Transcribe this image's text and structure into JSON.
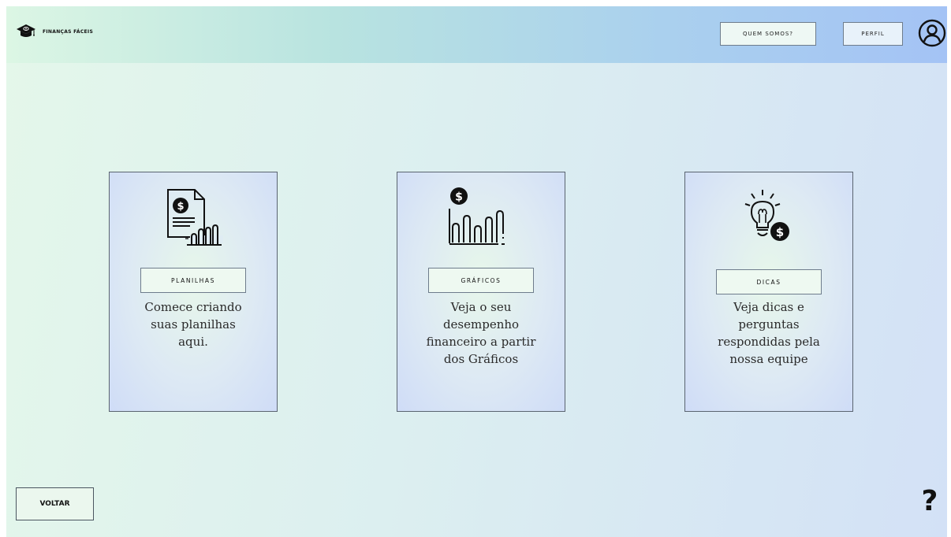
{
  "header": {
    "brand": "FINANÇAS FÁCEIS",
    "logo_icon": "graduation-cap-icon",
    "about_label": "QUEM SOMOS?",
    "profile_label": "PERFIL",
    "profile_icon": "user-circle-icon"
  },
  "cards": [
    {
      "icon": "spreadsheet-dollar-icon",
      "button_label": "PLANILHAS",
      "description": [
        "Comece criando",
        "suas planilhas",
        "aqui."
      ]
    },
    {
      "icon": "bar-chart-dollar-icon",
      "button_label": "GRÁFICOS",
      "description": [
        "Veja o seu",
        "desempenho",
        "financeiro a partir",
        "dos Gráficos"
      ]
    },
    {
      "icon": "lightbulb-dollar-icon",
      "button_label": "DICAS",
      "description": [
        "Veja dicas e",
        "perguntas",
        "respondidas pela",
        "nossa equipe"
      ]
    }
  ],
  "footer": {
    "back_label": "VOLTAR",
    "help_label": "?"
  }
}
